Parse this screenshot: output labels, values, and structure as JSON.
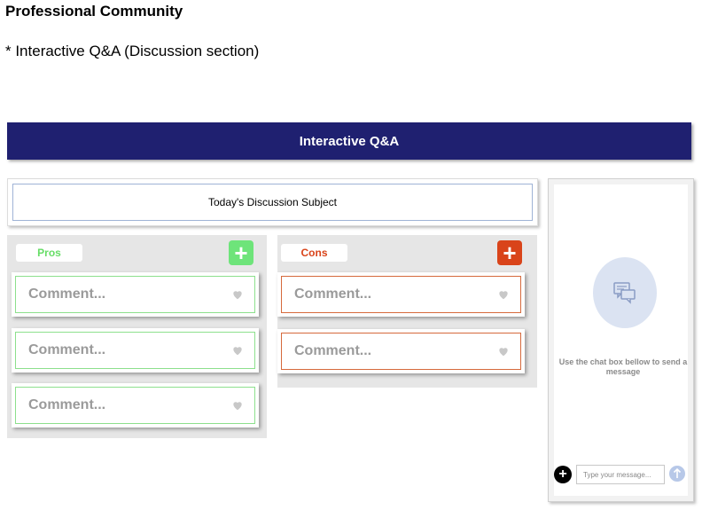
{
  "page": {
    "heading": "Professional Community",
    "subheading": "* Interactive Q&A (Discussion section)"
  },
  "banner": {
    "title": "Interactive Q&A",
    "color": "#1f2070"
  },
  "subject": {
    "label": "Today's Discussion Subject"
  },
  "pros": {
    "tag": "Pros",
    "accent": "#66dd66",
    "add_icon": "plus-icon",
    "comments": [
      {
        "text": "Comment..."
      },
      {
        "text": "Comment..."
      },
      {
        "text": "Comment..."
      }
    ]
  },
  "cons": {
    "tag": "Cons",
    "accent": "#d9441a",
    "add_icon": "plus-icon",
    "comments": [
      {
        "text": "Comment..."
      },
      {
        "text": "Comment..."
      }
    ]
  },
  "chat": {
    "icon": "chat-bubbles-icon",
    "hint": "Use the chat box bellow to send a message",
    "input_placeholder": "Type your message...",
    "add_icon": "plus-icon",
    "send_icon": "arrow-up-icon"
  }
}
